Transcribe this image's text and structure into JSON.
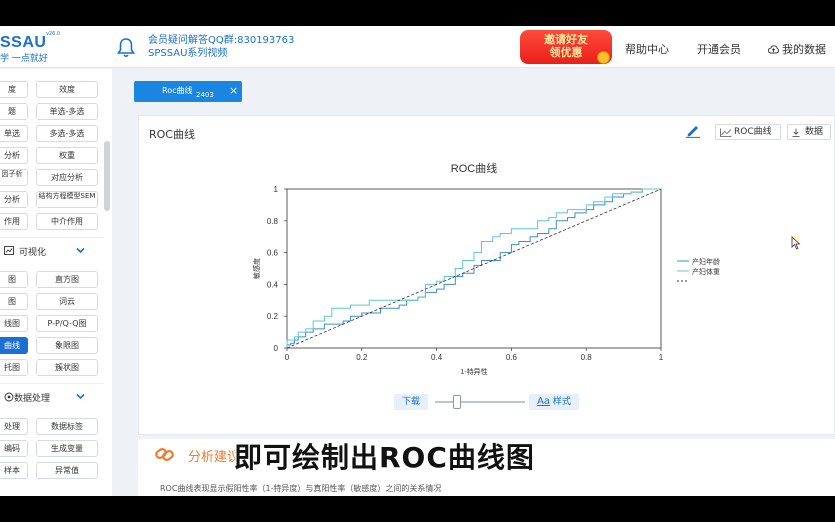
{
  "header": {
    "logo_text": "SSAU",
    "logo_sub": "学 一点就好",
    "logo_version": "v26.0",
    "qq_line": "会员疑问解答QQ群:830193763",
    "video_line": "SPSSAU系列视频",
    "invite_line1": "邀请好友",
    "invite_line2": "领优惠",
    "nav": [
      "帮助中心",
      "开通会员",
      "我的数据"
    ]
  },
  "sidebar": {
    "buttons": [
      [
        "度",
        "效度"
      ],
      [
        "题",
        "单选-多选"
      ],
      [
        "单选",
        "多选-多选"
      ],
      [
        "分析",
        "权重"
      ],
      [
        "因子析",
        "对应分析"
      ],
      [
        "分析",
        "结构方程模型SEM"
      ],
      [
        "作用",
        "中介作用"
      ]
    ],
    "section_viz": "可视化",
    "viz_buttons": [
      [
        "图",
        "直方图"
      ],
      [
        "图",
        "词云"
      ],
      [
        "线图",
        "P-P/Q-Q图"
      ],
      [
        "曲线",
        "象限图"
      ],
      [
        "托图",
        "簇状图"
      ]
    ],
    "section_data": "数据处理",
    "data_buttons": [
      [
        "处理",
        "数据标签"
      ],
      [
        "编码",
        "生成变量"
      ],
      [
        "样本",
        "异常值"
      ]
    ]
  },
  "tab": {
    "label": "Roc曲线",
    "close": "×",
    "number": "2403"
  },
  "panel": {
    "title": "ROC曲线",
    "roc_button": "ROC曲线",
    "data_button": "数据",
    "download": "下载",
    "style": "样式",
    "style_prefix": "Aa"
  },
  "chart_data": {
    "type": "line",
    "title": "ROC曲线",
    "xlabel": "1-特异性",
    "ylabel": "敏感度",
    "xlim": [
      0,
      1
    ],
    "ylim": [
      0,
      1
    ],
    "xticks": [
      "0",
      "0.2",
      "0.4",
      "0.6",
      "0.8",
      "1"
    ],
    "yticks": [
      "0",
      "0.2",
      "0.4",
      "0.6",
      "0.8",
      "1"
    ],
    "legend_position": "right",
    "series": [
      {
        "name": "产妇年龄",
        "color": "#3b8fd1",
        "x": [
          0,
          0.01,
          0.02,
          0.03,
          0.05,
          0.07,
          0.1,
          0.12,
          0.15,
          0.17,
          0.2,
          0.22,
          0.25,
          0.27,
          0.3,
          0.32,
          0.35,
          0.37,
          0.4,
          0.42,
          0.45,
          0.47,
          0.5,
          0.52,
          0.55,
          0.57,
          0.6,
          0.62,
          0.65,
          0.67,
          0.7,
          0.72,
          0.75,
          0.77,
          0.8,
          0.82,
          0.85,
          0.87,
          0.9,
          0.92,
          0.95,
          0.97,
          1
        ],
        "y": [
          0,
          0.02,
          0.03,
          0.05,
          0.07,
          0.1,
          0.12,
          0.15,
          0.15,
          0.17,
          0.2,
          0.22,
          0.22,
          0.25,
          0.25,
          0.27,
          0.3,
          0.32,
          0.35,
          0.37,
          0.4,
          0.45,
          0.47,
          0.52,
          0.55,
          0.55,
          0.6,
          0.65,
          0.67,
          0.7,
          0.72,
          0.75,
          0.8,
          0.82,
          0.85,
          0.87,
          0.9,
          0.92,
          0.95,
          0.97,
          0.98,
          1,
          1
        ]
      },
      {
        "name": "产妇体重",
        "color": "#5fc8c8",
        "x": [
          0,
          0.01,
          0.02,
          0.03,
          0.05,
          0.07,
          0.1,
          0.12,
          0.15,
          0.17,
          0.2,
          0.22,
          0.25,
          0.27,
          0.3,
          0.32,
          0.35,
          0.37,
          0.4,
          0.42,
          0.45,
          0.47,
          0.5,
          0.52,
          0.55,
          0.57,
          0.6,
          0.62,
          0.65,
          0.67,
          0.7,
          0.72,
          0.75,
          0.77,
          0.8,
          0.82,
          0.85,
          0.87,
          0.9,
          0.92,
          0.95,
          0.97,
          1
        ],
        "y": [
          0,
          0.05,
          0.05,
          0.07,
          0.1,
          0.12,
          0.17,
          0.2,
          0.25,
          0.25,
          0.27,
          0.27,
          0.3,
          0.3,
          0.3,
          0.3,
          0.3,
          0.32,
          0.4,
          0.42,
          0.45,
          0.5,
          0.55,
          0.6,
          0.67,
          0.7,
          0.72,
          0.75,
          0.75,
          0.75,
          0.8,
          0.82,
          0.85,
          0.87,
          0.87,
          0.9,
          0.92,
          0.95,
          0.97,
          0.97,
          0.98,
          1,
          1
        ]
      },
      {
        "name": "",
        "color": "#333333",
        "dashed": true,
        "x": [
          0,
          1
        ],
        "y": [
          0,
          1
        ]
      }
    ]
  },
  "analysis": {
    "heading": "分析建议",
    "body": "ROC曲线表现显示假阳性率（1-特异度）与真阳性率（敏感度）之间的关系情况"
  },
  "caption": "即可绘制出ROC曲线图"
}
